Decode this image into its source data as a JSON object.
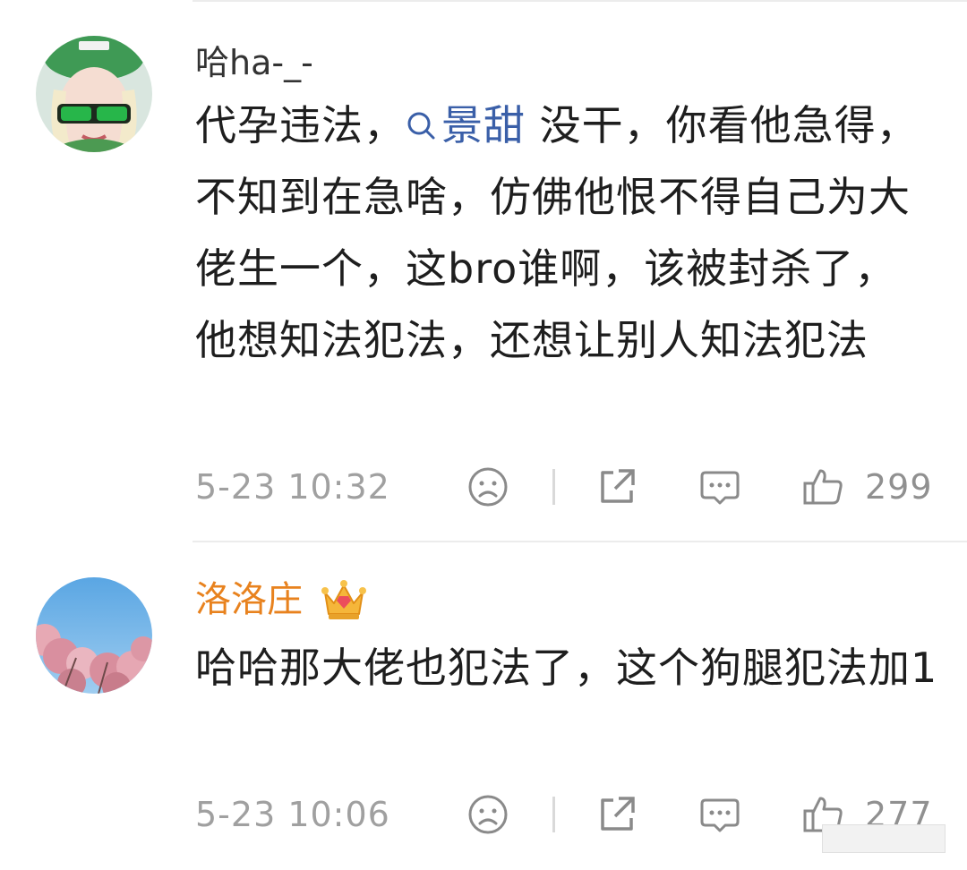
{
  "comments": [
    {
      "username": "哈ha-_-",
      "text_before": "代孕违法，",
      "mention": "景甜",
      "text_after": " 没干，你看他急得，不知到在急啥，仿佛他恨不得自己为大佬生一个，这bro谁啊，该被封杀了，他想知法犯法，还想让别人知法犯法",
      "timestamp": "5-23 10:32",
      "likes": "299"
    },
    {
      "username": "洛洛庄",
      "text": "哈哈那大佬也犯法了，这个狗腿犯法加1",
      "timestamp": "5-23 10:06",
      "likes": "277"
    }
  ],
  "icons": {
    "sad": "sad-face-icon",
    "share": "share-icon",
    "reply": "comment-icon",
    "like": "thumbs-up-icon",
    "badge": "crown-icon"
  },
  "colors": {
    "username_vip": "#e8821e",
    "mention": "#3a5fa8",
    "meta": "#a0a0a0"
  }
}
